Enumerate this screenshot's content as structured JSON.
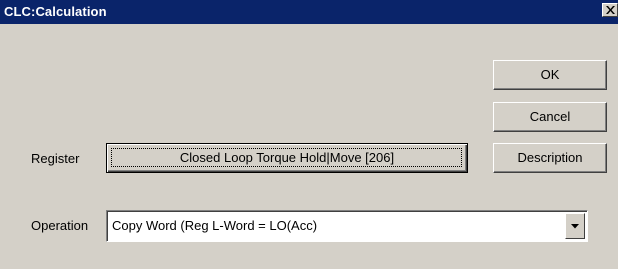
{
  "window": {
    "title": "CLC:Calculation",
    "title_bar_color": "#0a246a",
    "dialog_color": "#d4d0c8",
    "close_icon": "close-icon"
  },
  "buttons": {
    "ok_label": "OK",
    "cancel_label": "Cancel",
    "description_label": "Description"
  },
  "register": {
    "label": "Register",
    "value": "Closed Loop Torque Hold|Move [206]"
  },
  "operation": {
    "label": "Operation",
    "selected": "Copy Word (Reg L-Word = LO(Acc)",
    "dropdown_icon": "chevron-down-icon"
  }
}
